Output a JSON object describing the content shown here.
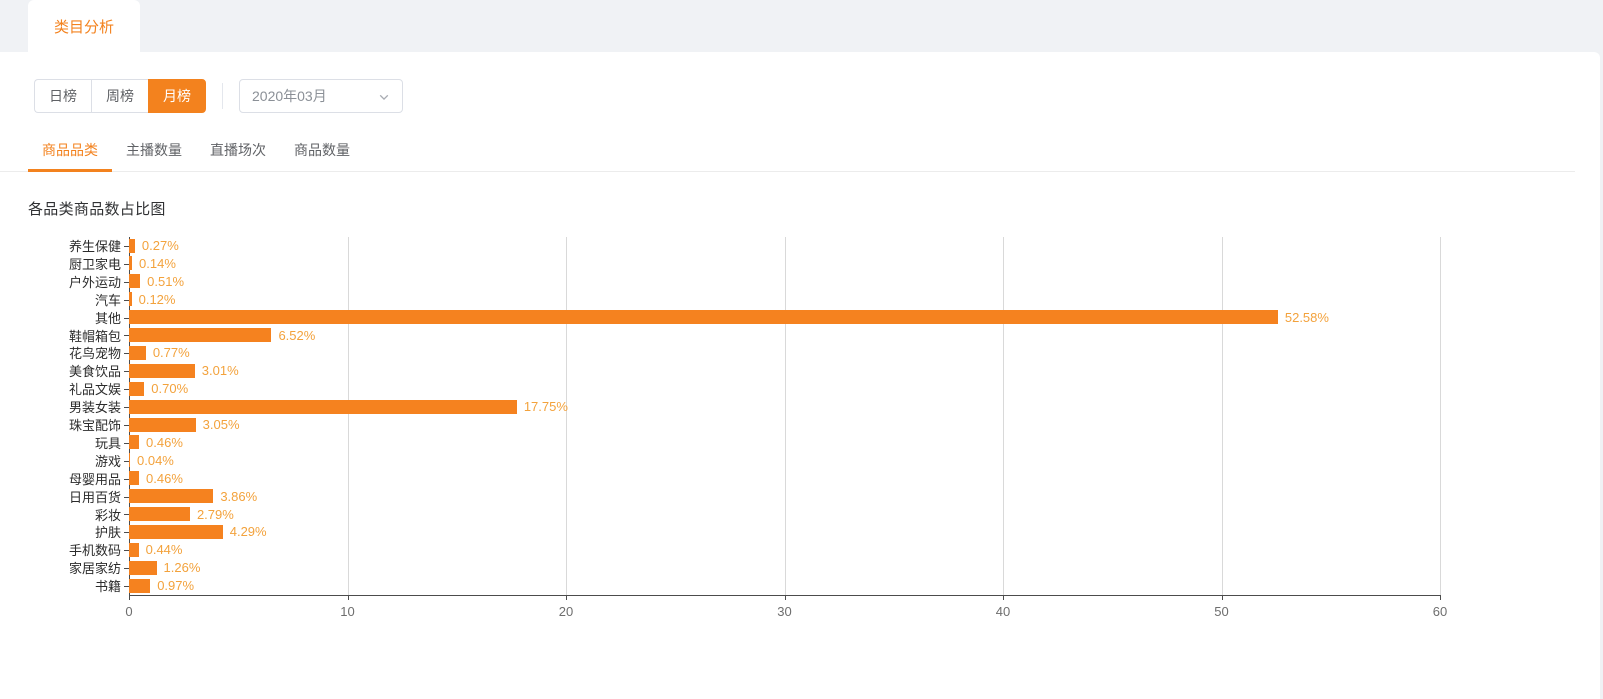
{
  "top_tabs": [
    {
      "label": "类目分析",
      "active": true
    }
  ],
  "filter_bar": {
    "range_buttons": [
      {
        "label": "日榜",
        "active": false
      },
      {
        "label": "周榜",
        "active": false
      },
      {
        "label": "月榜",
        "active": true
      }
    ],
    "period_select": {
      "value": "2020年03月",
      "icon": "chevron-down-icon"
    }
  },
  "sub_tabs": [
    {
      "label": "商品品类",
      "active": true
    },
    {
      "label": "主播数量",
      "active": false
    },
    {
      "label": "直播场次",
      "active": false
    },
    {
      "label": "商品数量",
      "active": false
    }
  ],
  "colors": {
    "accent": "#f3821e",
    "bar": "#f5821f",
    "bar_label": "#f3a23c",
    "page_bg": "#f0f2f5",
    "card_bg": "#ffffff",
    "gridline": "#d9d9d9",
    "axis": "#4c4c4c"
  },
  "chart_data": {
    "type": "bar",
    "orientation": "horizontal",
    "title": "各品类商品数占比图",
    "xlabel": "",
    "ylabel": "",
    "xlim": [
      0,
      60
    ],
    "xticks": [
      0,
      10,
      20,
      30,
      40,
      50,
      60
    ],
    "grid": true,
    "legend": false,
    "unit": "%",
    "categories": [
      "养生保健",
      "厨卫家电",
      "户外运动",
      "汽车",
      "其他",
      "鞋帽箱包",
      "花鸟宠物",
      "美食饮品",
      "礼品文娱",
      "男装女装",
      "珠宝配饰",
      "玩具",
      "游戏",
      "母婴用品",
      "日用百货",
      "彩妆",
      "护肤",
      "手机数码",
      "家居家纺",
      "书籍"
    ],
    "values": [
      0.27,
      0.14,
      0.51,
      0.12,
      52.58,
      6.52,
      0.77,
      3.01,
      0.7,
      17.75,
      3.05,
      0.46,
      0.04,
      0.46,
      3.86,
      2.79,
      4.29,
      0.44,
      1.26,
      0.97
    ],
    "data_labels": [
      "0.27%",
      "0.14%",
      "0.51%",
      "0.12%",
      "52.58%",
      "6.52%",
      "0.77%",
      "3.01%",
      "0.70%",
      "17.75%",
      "3.05%",
      "0.46%",
      "0.04%",
      "0.46%",
      "3.86%",
      "2.79%",
      "4.29%",
      "0.44%",
      "1.26%",
      "0.97%"
    ]
  }
}
